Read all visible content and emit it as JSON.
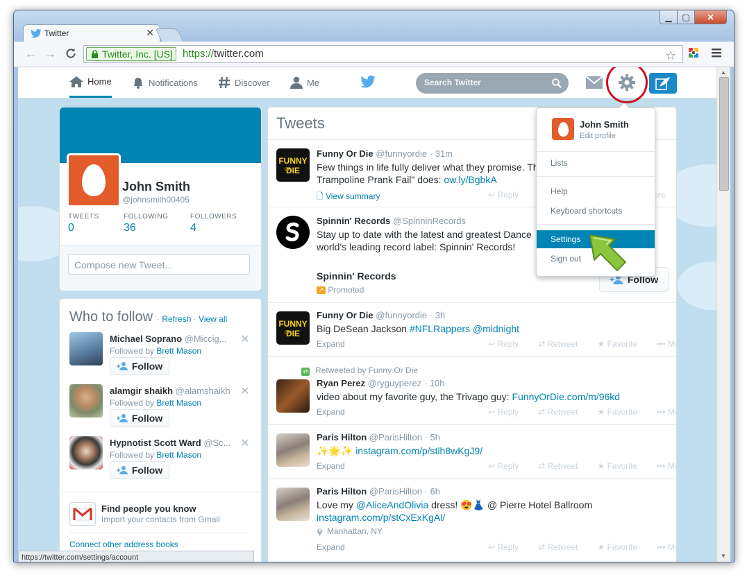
{
  "browser": {
    "tab_title": "Twitter",
    "ev_label": "Twitter, Inc. [US]",
    "url_scheme": "https://",
    "url_host": "twitter.com",
    "status_url": "https://twitter.com/settings/account"
  },
  "nav": {
    "home": "Home",
    "notifications": "Notifications",
    "discover": "Discover",
    "me": "Me",
    "search_placeholder": "Search Twitter"
  },
  "profile": {
    "name": "John Smith",
    "handle": "@johnsmith00405",
    "stats": [
      {
        "label": "TWEETS",
        "value": "0"
      },
      {
        "label": "FOLLOWING",
        "value": "36"
      },
      {
        "label": "FOLLOWERS",
        "value": "4"
      }
    ],
    "compose_placeholder": "Compose new Tweet..."
  },
  "who_to_follow": {
    "title": "Who to follow",
    "sep": " · ",
    "refresh": "Refresh",
    "view_all": "View all",
    "followed_by_prefix": "Followed by ",
    "follow_label": "Follow",
    "close_glyph": "✕",
    "suggestions": [
      {
        "name": "Michael Soprano",
        "handle": "@Miccig...",
        "followed_by": "Brett Mason"
      },
      {
        "name": "alamgir shaikh",
        "handle": "@alamshaikh",
        "followed_by": "Brett Mason"
      },
      {
        "name": "Hypnotist Scott Ward",
        "handle": "@Sc...",
        "followed_by": "Brett Mason"
      }
    ],
    "find_title": "Find people you know",
    "find_sub": "Import your contacts from Gmail",
    "connect": "Connect other address books"
  },
  "stream": {
    "title": "Tweets",
    "actions": {
      "reply": "Reply",
      "retweet": "Retweet",
      "favorite": "Favorite",
      "more": "More"
    },
    "tweets": [
      {
        "name": "Funny Or Die",
        "handle": "@funnyordie",
        "time": "· 31m",
        "line1": "Few things in life fully deliver what they promise. Th",
        "line2_text": "Trampoline Prank Fail\" does: ",
        "line2_link": "ow.ly/BgbkA",
        "footer": "View summary"
      },
      {
        "name": "Spinnin' Records",
        "handle": "@SpinninRecords",
        "line1": "Stay up to date with the latest and greatest Dance",
        "line2_text": "world's leading record label: Spinnin' Records!",
        "promoted_name": "Spinnin' Records",
        "promoted_label": "Promoted",
        "follow_label": "Follow"
      },
      {
        "name": "Funny Or Die",
        "handle": "@funnyordie",
        "time": "· 3h",
        "line1_text": "Big DeSean Jackson ",
        "line1_link": "#NFLRappers @midnight",
        "footer": "Expand"
      },
      {
        "retweeted_by": "Retweeted by Funny Or Die",
        "name": "Ryan Perez",
        "handle": "@ryguyperez",
        "time": "· 10h",
        "line1_text": "video about my favorite guy, the Trivago guy:  ",
        "line1_link": "FunnyOrDie.com/m/96kd",
        "footer": "Expand"
      },
      {
        "name": "Paris Hilton",
        "handle": "@ParisHilton",
        "time": "· 5h",
        "line1_emoji": "✨🌟✨ ",
        "line1_link": "instagram.com/p/stlh8wKgJ9/",
        "footer": "Expand"
      },
      {
        "name": "Paris Hilton",
        "handle": "@ParisHilton",
        "time": "· 6h",
        "line1_text": "Love my ",
        "line1_link": "@AliceAndOlivia",
        "line1_tail": " dress! 😍👗 @ Pierre Hotel Ballroom",
        "line2_link": "instagram.com/p/stCxExKgAl/",
        "location": "Manhattan, NY",
        "footer": "Expand"
      }
    ]
  },
  "dropdown": {
    "name": "John Smith",
    "edit_profile": "Edit profile",
    "lists": "Lists",
    "help": "Help",
    "keyboard": "Keyboard shortcuts",
    "settings": "Settings",
    "signout": "Sign out"
  },
  "colors": {
    "twitter_blue": "#0084b4",
    "egg_orange": "#e35c2b",
    "annotation_red": "#d0101c",
    "annotation_green": "#8cc63f"
  }
}
